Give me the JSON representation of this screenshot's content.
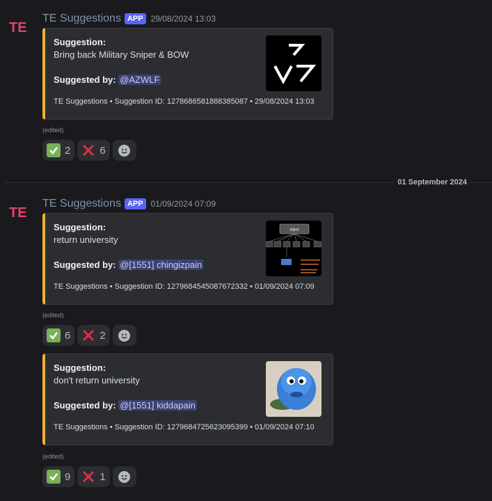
{
  "messages": [
    {
      "username": "TE Suggestions",
      "badge": "APP",
      "timestamp": "29/08/2024 13:03",
      "embed": {
        "title": "Suggestion:",
        "text": "Bring back Military Sniper & BOW",
        "suggested_by_label": "Suggested by:",
        "mention": "@AZWLF",
        "footer": "TE Suggestions • Suggestion ID: 1278686581888385087 • 29/08/2024 13:03",
        "thumbnail_icon": "logo-thumbnail"
      },
      "edited": "(edited)",
      "reactions": [
        {
          "emoji": "check-mark-icon",
          "count": "2"
        },
        {
          "emoji": "cross-mark-icon",
          "count": "6"
        }
      ]
    },
    {
      "username": "TE Suggestions",
      "badge": "APP",
      "timestamp": "01/09/2024 07:09",
      "embed": {
        "title": "Suggestion:",
        "text": "return university",
        "suggested_by_label": "Suggested by:",
        "mention": "@[1551] chingizpain",
        "footer": "TE Suggestions • Suggestion ID: 1279684545087672332 • 01/09/2024 07:09",
        "thumbnail_icon": "diagram-thumbnail",
        "thumbnail_text": "object"
      },
      "edited": "(edited)",
      "reactions": [
        {
          "emoji": "check-mark-icon",
          "count": "6"
        },
        {
          "emoji": "cross-mark-icon",
          "count": "2"
        }
      ]
    },
    {
      "embed": {
        "title": "Suggestion:",
        "text": "don't return university",
        "suggested_by_label": "Suggested by:",
        "mention": "@[1551] kiddapain",
        "footer": "TE Suggestions • Suggestion ID: 1279684725623095399 • 01/09/2024 07:10",
        "thumbnail_icon": "blue-fish-thumbnail"
      },
      "edited": "(edited)",
      "reactions": [
        {
          "emoji": "check-mark-icon",
          "count": "9"
        },
        {
          "emoji": "cross-mark-icon",
          "count": "1"
        }
      ]
    }
  ],
  "date_divider": "01 September 2024",
  "colors": {
    "accent_bar": "#f0b132",
    "app_badge": "#5865f2",
    "mention_bg": "#3c4270",
    "check_green": "#78b159",
    "cross_red": "#dd2e44"
  }
}
